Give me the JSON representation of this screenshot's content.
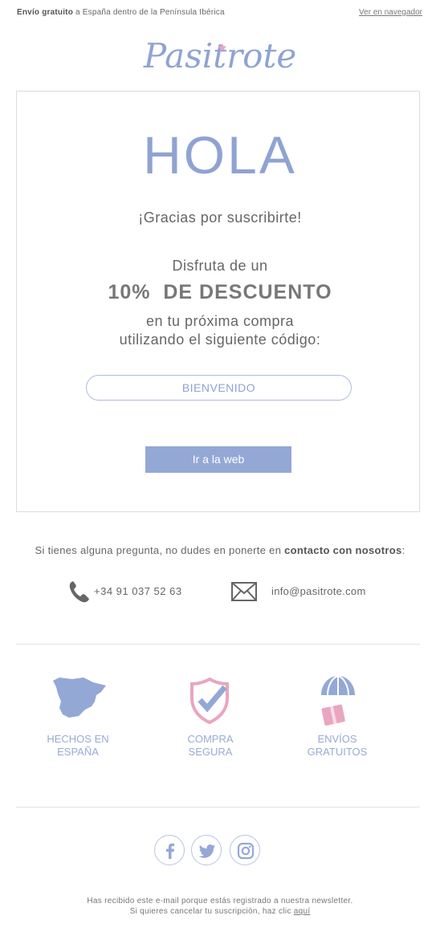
{
  "topbar": {
    "shipping_bold": "Envío gratuito",
    "shipping_rest": " a España dentro de la Península Ibérica",
    "view_in_browser": "Ver en navegador"
  },
  "brand": {
    "logo_text": "Pasitrote",
    "logo_color": "#8fa3d3",
    "logo_star_color": "#e9a6bf"
  },
  "hero": {
    "greeting": "HOLA",
    "thanks": "¡Gracias por suscribirte!",
    "enjoy": "Disfruta de un",
    "discount": "10%  DE DESCUENTO",
    "next_purchase": "en tu próxima compra",
    "using_code": "utilizando el siguiente código:",
    "code": "BIENVENIDO",
    "cta": "Ir a la web"
  },
  "contact": {
    "question": "Si tienes alguna pregunta, no dudes en ponerte en ",
    "question_bold": "contacto con nosotros",
    "question_end": ":",
    "phone": "+34 91 037 52 63",
    "email": "info@pasitrote.com",
    "phone_icon": "phone-icon",
    "mail_icon": "envelope-icon"
  },
  "features": [
    {
      "line1": "HECHOS EN",
      "line2": "ESPAÑA",
      "icon": "spain-map-icon"
    },
    {
      "line1": "COMPRA",
      "line2": "SEGURA",
      "icon": "shield-check-icon"
    },
    {
      "line1": "ENVÍOS",
      "line2": "GRATUITOS",
      "icon": "parachute-box-icon"
    }
  ],
  "social": [
    "facebook-icon",
    "twitter-icon",
    "instagram-icon"
  ],
  "footer": {
    "line1": "Has recibido este e-mail porque estás registrado a nuestra newsletter.",
    "line2": "Si quieres cancelar tu suscripción, haz clic ",
    "unsubscribe_link": "aquí"
  },
  "colors": {
    "accent": "#8fa3d3",
    "button": "#94a8d6",
    "pink": "#e9a6bf",
    "text": "#666666"
  }
}
